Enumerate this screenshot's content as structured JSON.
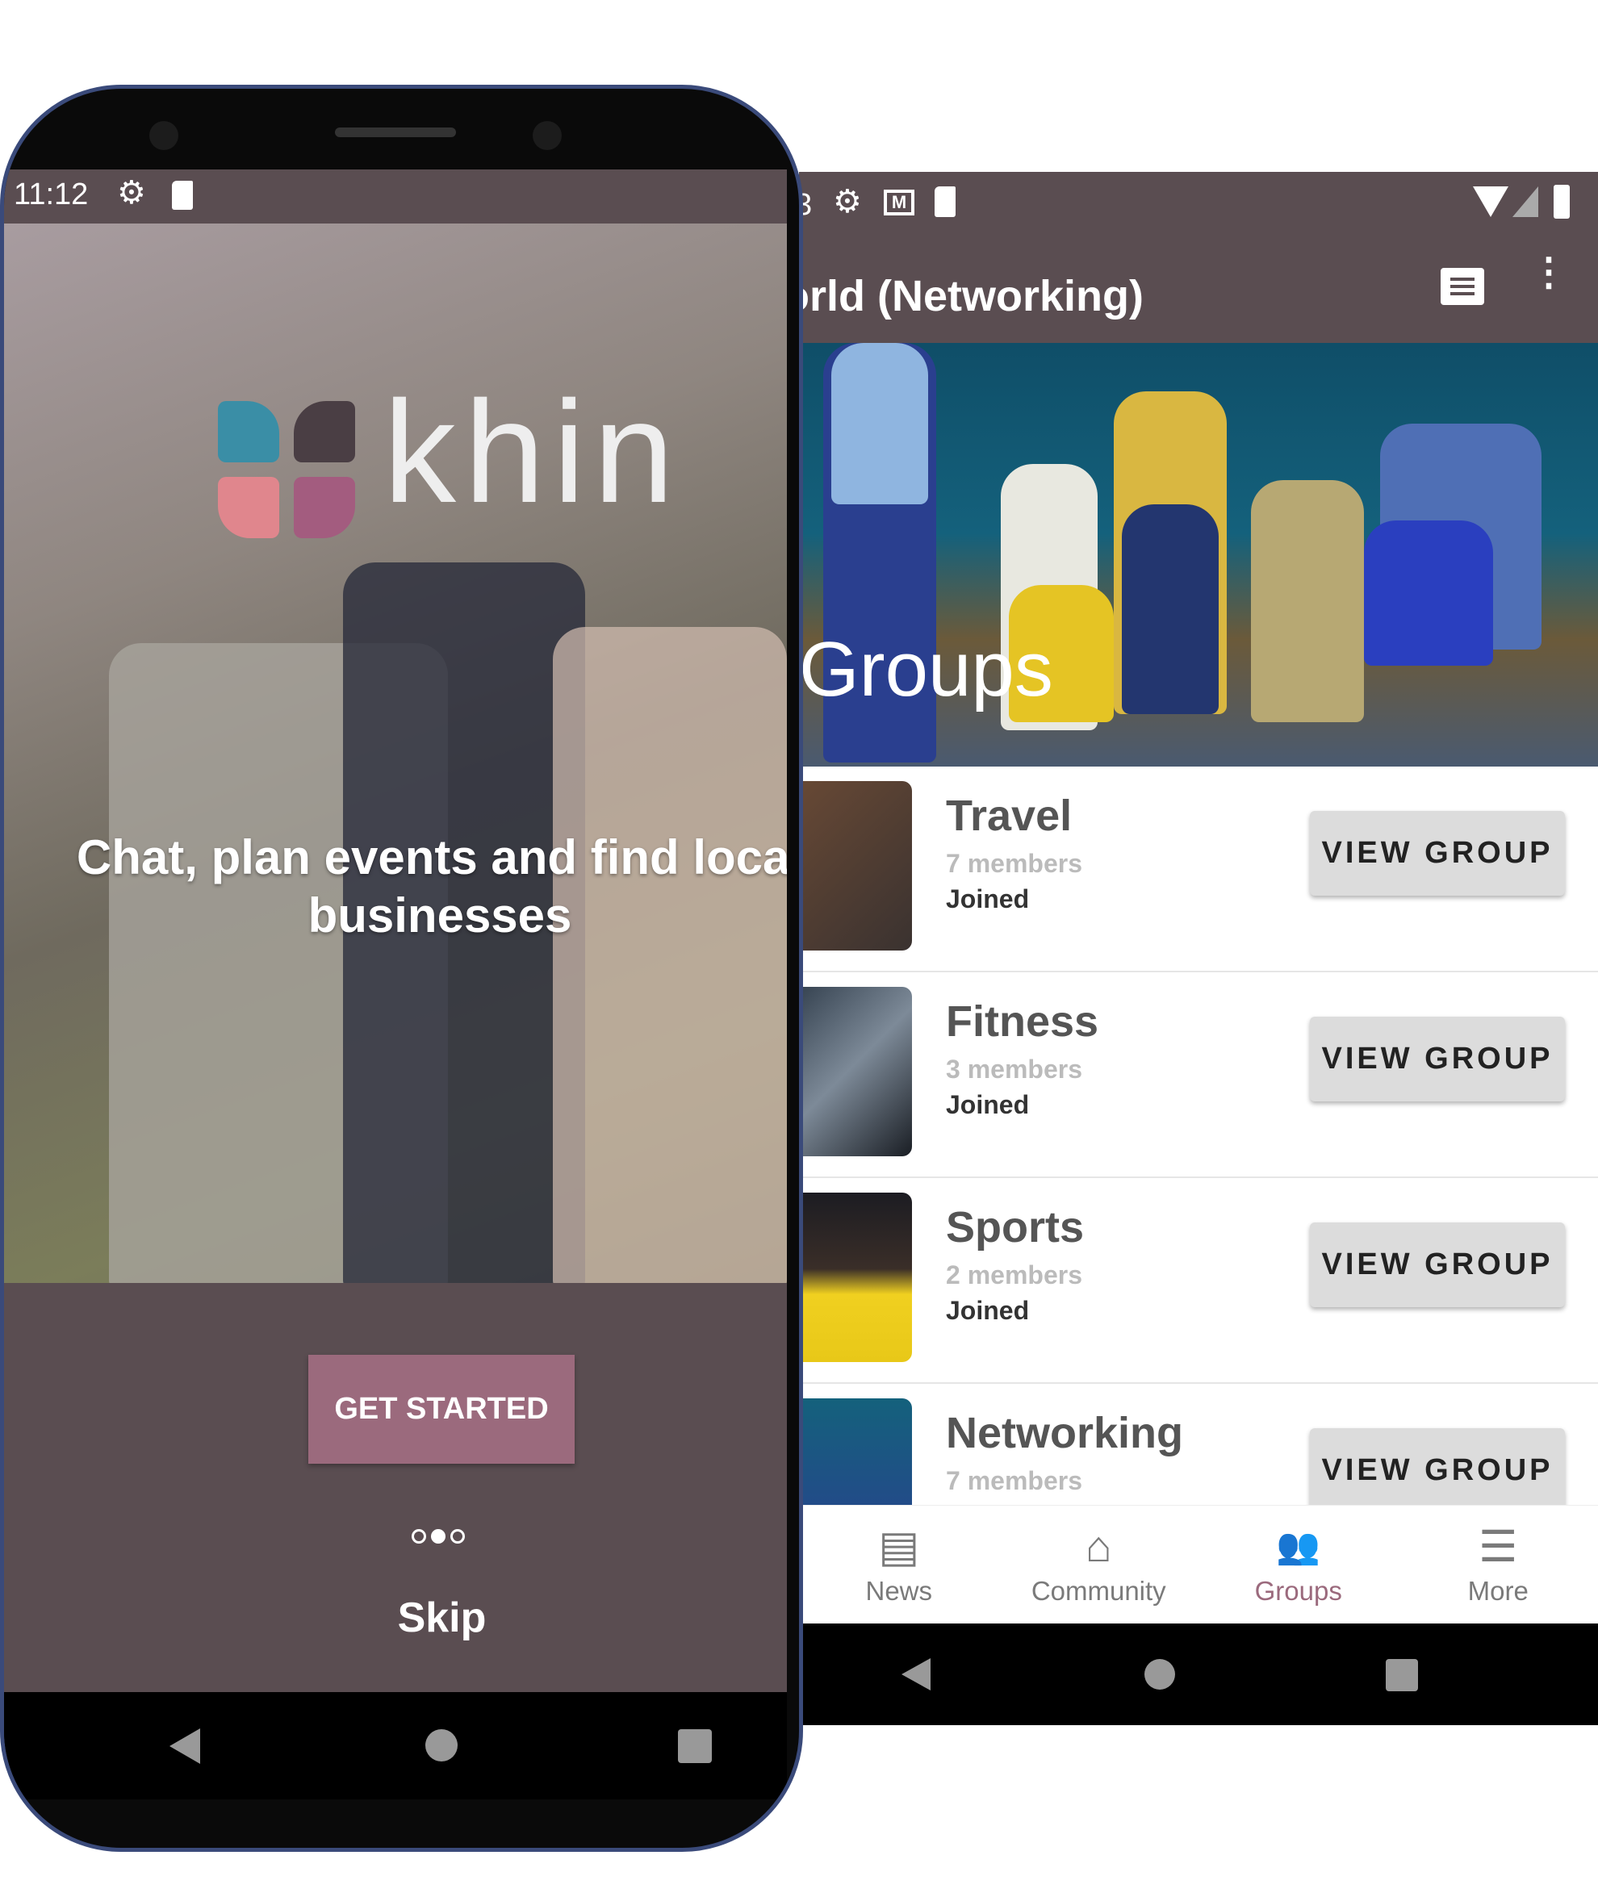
{
  "right_phone": {
    "status": {
      "time_fragment": "3",
      "icons": [
        "gear-icon",
        "gmail-icon",
        "sd-card-icon",
        "wifi-icon",
        "signal-icon",
        "battery-icon"
      ]
    },
    "appbar": {
      "title": "orld (Networking)",
      "icons": [
        "chat-icon",
        "more-vert-icon"
      ]
    },
    "hero": {
      "title": "Groups"
    },
    "groups": [
      {
        "name": "Travel",
        "members": "7 members",
        "status": "Joined",
        "button": "VIEW GROUP"
      },
      {
        "name": "Fitness",
        "members": "3 members",
        "status": "Joined",
        "button": "VIEW GROUP"
      },
      {
        "name": "Sports",
        "members": "2 members",
        "status": "Joined",
        "button": "VIEW GROUP"
      },
      {
        "name": "Networking",
        "members": "7 members",
        "button": "VIEW GROUP"
      }
    ],
    "bottom_nav": [
      {
        "label": "News",
        "icon": "newspaper-icon",
        "icon_glyph": "▤"
      },
      {
        "label": "Community",
        "icon": "home-icon",
        "icon_glyph": "⌂"
      },
      {
        "label": "Groups",
        "icon": "people-icon",
        "icon_glyph": "👥",
        "active": true
      },
      {
        "label": "More",
        "icon": "menu-icon",
        "icon_glyph": "☰"
      }
    ],
    "active_color": "#9b6a7d"
  },
  "left_phone": {
    "status": {
      "time": "11:12"
    },
    "logo": "khin",
    "headline": "Chat, plan events and find local businesses",
    "cta": "GET STARTED",
    "pagination": {
      "total": 3,
      "current": 2
    },
    "skip": "Skip"
  },
  "colors": {
    "primary": "#5a4d51",
    "accent": "#9b6a7d"
  }
}
